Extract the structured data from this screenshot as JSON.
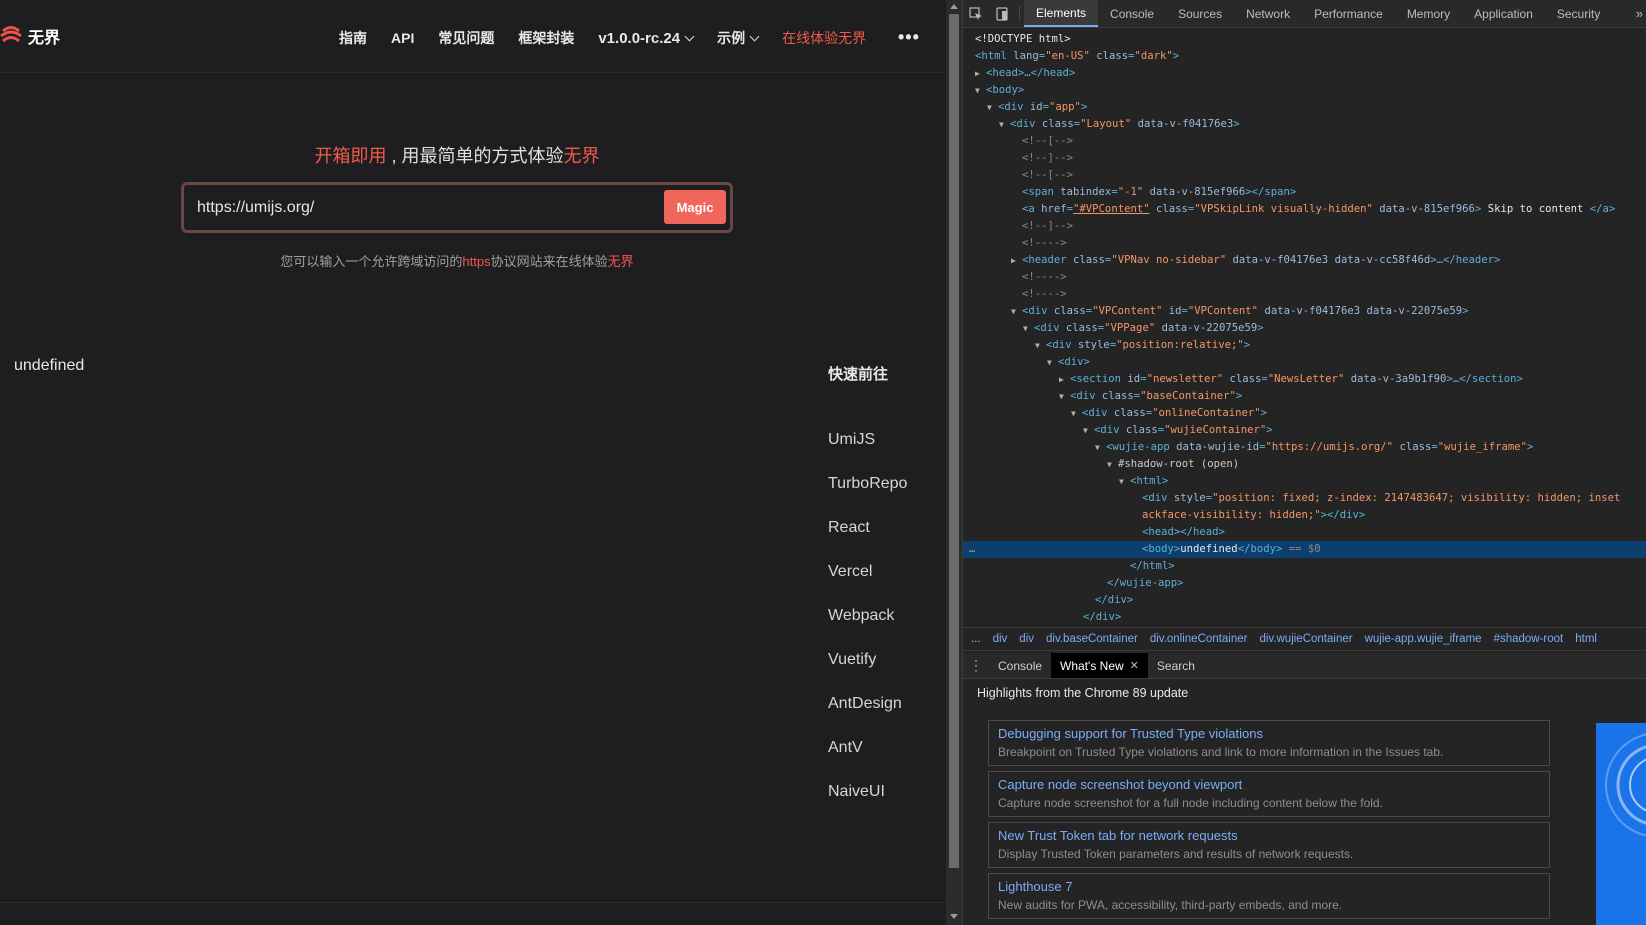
{
  "app": {
    "logo_text": "无界",
    "nav": [
      "指南",
      "API",
      "常见问题",
      "框架封装"
    ],
    "version": "v1.0.0-rc.24",
    "examples": "示例",
    "try_online": "在线体验无界",
    "more": "•••",
    "hero": {
      "part1": "开箱即用",
      "part2": " , 用最简单的方式体验",
      "part3": "无界"
    },
    "url_value": "https://umijs.org/",
    "magic_button": "Magic",
    "hint": {
      "part1": "您可以输入一个允许跨域访问的",
      "part2": "https",
      "part3": "协议网站来在线体验",
      "part4": "无界"
    },
    "body_text": "undefined",
    "quick_title": "快速前往",
    "quick_links": [
      "UmiJS",
      "TurboRepo",
      "React",
      "Vercel",
      "Webpack",
      "Vuetify",
      "AntDesign",
      "AntV",
      "NaiveUI"
    ]
  },
  "devtools": {
    "tabs": [
      "Elements",
      "Console",
      "Sources",
      "Network",
      "Performance",
      "Memory",
      "Application",
      "Security"
    ],
    "active_tab": "Elements",
    "overflow": "»",
    "breadcrumbs": [
      "div",
      "div",
      "div.baseContainer",
      "div.onlineContainer",
      "div.wujieContainer",
      "wujie-app.wujie_iframe",
      "#shadow-root",
      "html"
    ],
    "breadcrumbs_dots": "...",
    "drawer_tabs": [
      "Console",
      "What's New",
      "Search"
    ],
    "drawer_active": "What's New",
    "whats_new_heading": "Highlights from the Chrome 89 update",
    "whats_new_items": [
      {
        "title": "Debugging support for Trusted Type violations",
        "desc": "Breakpoint on Trusted Type violations and link to more information in the Issues tab."
      },
      {
        "title": "Capture node screenshot beyond viewport",
        "desc": "Capture node screenshot for a full node including content below the fold."
      },
      {
        "title": "New Trust Token tab for network requests",
        "desc": "Display Trusted Token parameters and results of network requests."
      },
      {
        "title": "Lighthouse 7",
        "desc": "New audits for PWA, accessibility, third-party embeds, and more."
      }
    ],
    "dom": {
      "l01": "<!DOCTYPE html>",
      "l02_open": "<html ",
      "l02_a1": "lang",
      "l02_v1": "\"en-US\"",
      "l02_a2": "class",
      "l02_v2": "\"dark\"",
      "l02_close": ">",
      "l03": "<head>…</head>",
      "l04": "<body>",
      "l05_open": "<div ",
      "l05_a": "id",
      "l05_v": "\"app\"",
      "l05_close": ">",
      "l06_open": "<div ",
      "l06_a1": "class",
      "l06_v1": "\"Layout\"",
      "l06_a2": "data-v-f04176e3",
      "l06_close": ">",
      "l07": "<!--[-->",
      "l08": "<!--]-->",
      "l09": "<!--[-->",
      "l10_open": "<span ",
      "l10_a1": "tabindex",
      "l10_v1": "\"-1\"",
      "l10_a2": "data-v-815ef966",
      "l10_close": "></span>",
      "l11_open": "<a ",
      "l11_a1": "href",
      "l11_v1": "\"#VPContent\"",
      "l11_a2": "class",
      "l11_v2": "\"VPSkipLink visually-hidden\"",
      "l11_a3": "data-v-815ef966",
      "l11_mid": ">",
      "l11_text": " Skip to content ",
      "l11_close": "</a>",
      "l12": "<!--]-->",
      "l13": "<!---->",
      "l14_open": "<header ",
      "l14_a1": "class",
      "l14_v1": "\"VPNav no-sidebar\"",
      "l14_a2": "data-v-f04176e3 data-v-cc58f46d",
      "l14_close": ">…</header>",
      "l15": "<!---->",
      "l16": "<!---->",
      "l17_open": "<div ",
      "l17_a1": "class",
      "l17_v1": "\"VPContent\"",
      "l17_a2": "id",
      "l17_v2": "\"VPContent\"",
      "l17_a3": "data-v-f04176e3 data-v-22075e59",
      "l17_close": ">",
      "l18_open": "<div ",
      "l18_a1": "class",
      "l18_v1": "\"VPPage\"",
      "l18_a2": "data-v-22075e59",
      "l18_close": ">",
      "l19_open": "<div ",
      "l19_a1": "style",
      "l19_v1": "\"position:relative;\"",
      "l19_close": ">",
      "l20": "<div>",
      "l21_open": "<section ",
      "l21_a1": "id",
      "l21_v1": "\"newsletter\"",
      "l21_a2": "class",
      "l21_v2": "\"NewsLetter\"",
      "l21_a3": "data-v-3a9b1f90",
      "l21_close": ">…</section>",
      "l22_open": "<div ",
      "l22_a1": "class",
      "l22_v1": "\"baseContainer\"",
      "l22_close": ">",
      "l23_open": "<div ",
      "l23_a1": "class",
      "l23_v1": "\"onlineContainer\"",
      "l23_close": ">",
      "l24_open": "<div ",
      "l24_a1": "class",
      "l24_v1": "\"wujieContainer\"",
      "l24_close": ">",
      "l25_open": "<wujie-app ",
      "l25_a1": "data-wujie-id",
      "l25_v1": "\"https://umijs.org/\"",
      "l25_a2": "class",
      "l25_v2": "\"wujie_iframe\"",
      "l25_close": ">",
      "l26": "#shadow-root (open)",
      "l27": "<html>",
      "l28_open": "<div ",
      "l28_a1": "style",
      "l28_v1": "\"position: fixed; z-index: 2147483647; visibility: hidden; inset",
      "l29_v": "ackface-visibility: hidden;\"",
      "l29_close": "></div>",
      "l30": "<head></head>",
      "l31_open": "<body>",
      "l31_text": "undefined",
      "l31_close": "</body>",
      "l31_eq": " == $0",
      "l31_dots": "…",
      "l32": "</html>",
      "l33": "</wujie-app>",
      "l34": "</div>",
      "l35": "</div>"
    }
  }
}
